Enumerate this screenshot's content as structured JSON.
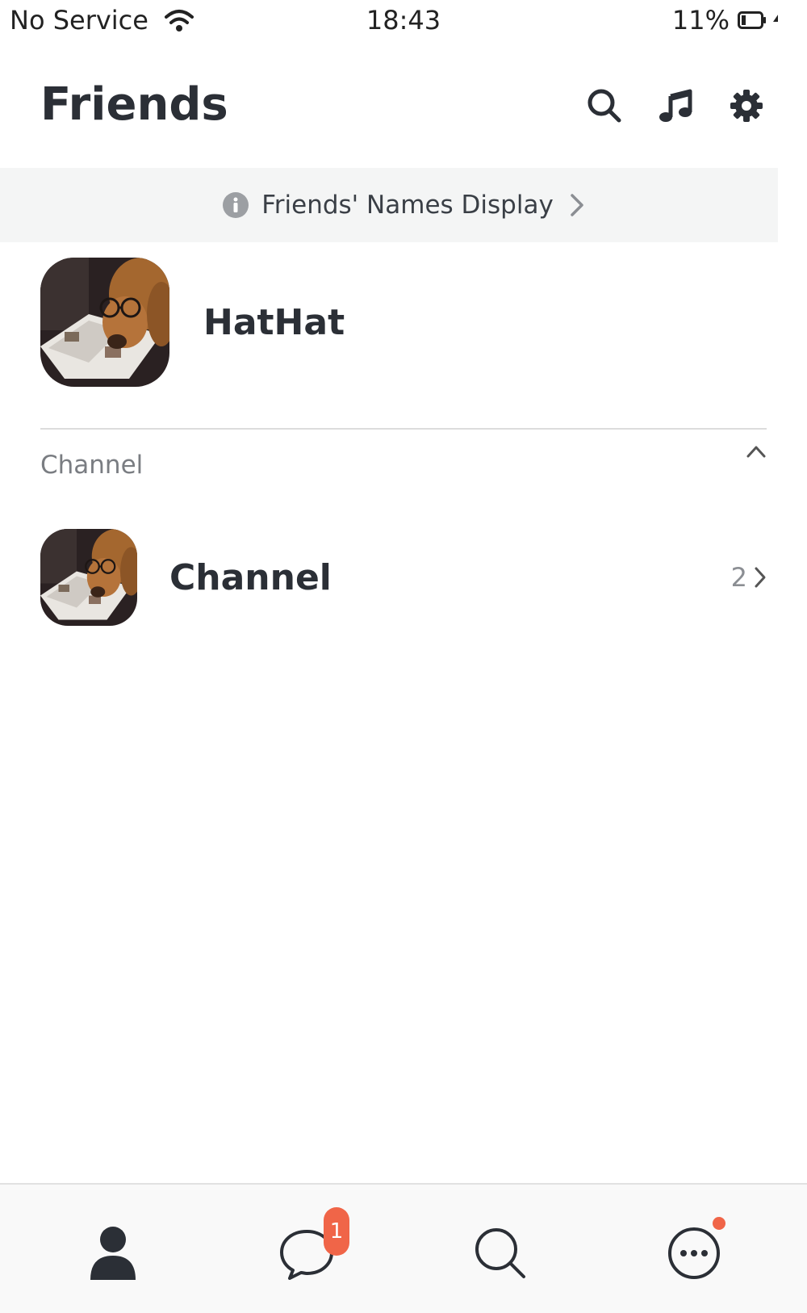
{
  "status_bar": {
    "carrier": "No Service",
    "time": "18:43",
    "battery": "11%"
  },
  "header": {
    "title": "Friends",
    "icons": [
      "search-icon",
      "music-icon",
      "gear-icon"
    ]
  },
  "banner": {
    "label": "Friends' Names Display"
  },
  "profile": {
    "name": "HatHat"
  },
  "section": {
    "title": "Channel"
  },
  "channel": {
    "name": "Channel",
    "count": "2"
  },
  "bottom_nav": {
    "items": [
      {
        "icon": "person-icon"
      },
      {
        "icon": "chat-icon",
        "badge": "1"
      },
      {
        "icon": "search-icon"
      },
      {
        "icon": "more-icon"
      }
    ]
  },
  "colors": {
    "accent": "#f06548",
    "text": "#2b2f36",
    "banner_bg": "#f4f5f5"
  }
}
